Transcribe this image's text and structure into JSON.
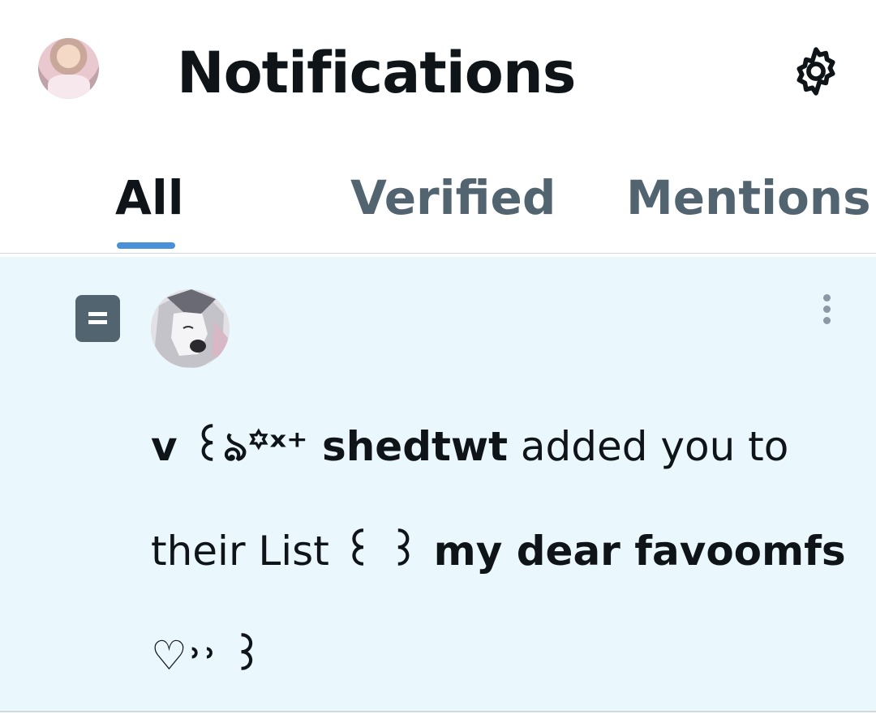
{
  "header": {
    "title": "Notifications",
    "settings_icon": "gear-icon"
  },
  "tabs": [
    {
      "label": "All",
      "active": true
    },
    {
      "label": "Verified",
      "active": false
    },
    {
      "label": "Mentions",
      "active": false
    }
  ],
  "notification": {
    "type_icon": "list-icon",
    "sender_name": "v ꒰ঌ꙳ˣ⁺ shedtwt",
    "message_mid": " added you to their List ",
    "list_name": "꒰ ꒱ my dear favoomfs ♡˒˒ ꒱",
    "more_icon": "more-vertical-icon"
  },
  "colors": {
    "accent": "#4a90d9",
    "highlight_bg": "#eaf7fc",
    "muted_text": "#536471"
  }
}
